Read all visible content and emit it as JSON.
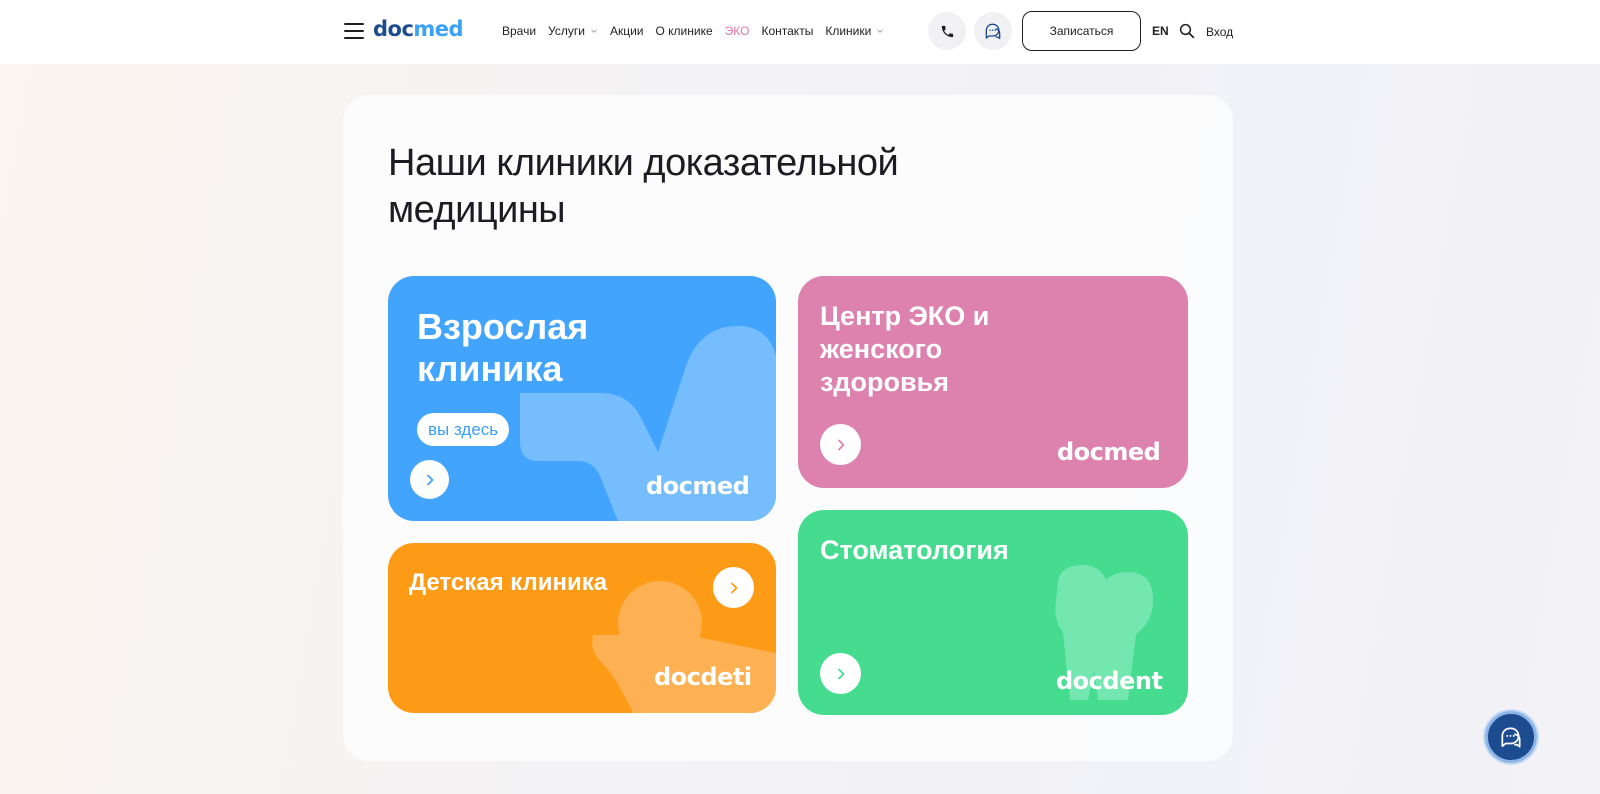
{
  "header": {
    "logo_part1": "doc",
    "logo_part2": "med",
    "nav": [
      {
        "label": "Врачи",
        "dropdown": false
      },
      {
        "label": "Услуги",
        "dropdown": true
      },
      {
        "label": "Акции",
        "dropdown": false
      },
      {
        "label": "О клинике",
        "dropdown": false
      },
      {
        "label": "ЭКО",
        "dropdown": false,
        "highlight": true
      },
      {
        "label": "Контакты",
        "dropdown": false
      },
      {
        "label": "Клиники",
        "dropdown": true
      }
    ],
    "signup_label": "Записаться",
    "lang_label": "EN",
    "login_label": "Вход"
  },
  "main": {
    "title": "Наши клиники доказательной медицины",
    "cards": {
      "adult": {
        "title": "Взрослая клиника",
        "badge": "вы здесь",
        "logo": "docmed",
        "color": "#42a4fd"
      },
      "eco": {
        "title": "Центр ЭКО и женского здоровья",
        "logo": "docmed",
        "color": "#dd82ae"
      },
      "kids": {
        "title": "Детская клиника",
        "logo": "docdeti",
        "color": "#fd9b17"
      },
      "dental": {
        "title": "Стоматология",
        "logo": "docdent",
        "color": "#46dc90"
      }
    }
  },
  "colors": {
    "brand_dark": "#1d4b8f",
    "brand_light": "#3aa1f3",
    "highlight": "#e072a4"
  },
  "icons": [
    "menu-icon",
    "phone-icon",
    "chat-icon",
    "search-icon",
    "chevron-right-icon",
    "chevron-down-icon"
  ]
}
